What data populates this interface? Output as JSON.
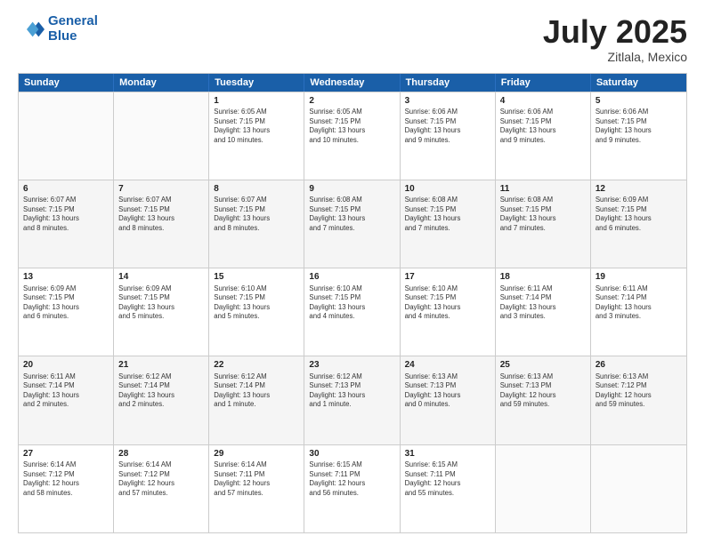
{
  "logo": {
    "line1": "General",
    "line2": "Blue"
  },
  "title": "July 2025",
  "subtitle": "Zitlala, Mexico",
  "headers": [
    "Sunday",
    "Monday",
    "Tuesday",
    "Wednesday",
    "Thursday",
    "Friday",
    "Saturday"
  ],
  "weeks": [
    [
      {
        "day": "",
        "info": ""
      },
      {
        "day": "",
        "info": ""
      },
      {
        "day": "1",
        "info": "Sunrise: 6:05 AM\nSunset: 7:15 PM\nDaylight: 13 hours\nand 10 minutes."
      },
      {
        "day": "2",
        "info": "Sunrise: 6:05 AM\nSunset: 7:15 PM\nDaylight: 13 hours\nand 10 minutes."
      },
      {
        "day": "3",
        "info": "Sunrise: 6:06 AM\nSunset: 7:15 PM\nDaylight: 13 hours\nand 9 minutes."
      },
      {
        "day": "4",
        "info": "Sunrise: 6:06 AM\nSunset: 7:15 PM\nDaylight: 13 hours\nand 9 minutes."
      },
      {
        "day": "5",
        "info": "Sunrise: 6:06 AM\nSunset: 7:15 PM\nDaylight: 13 hours\nand 9 minutes."
      }
    ],
    [
      {
        "day": "6",
        "info": "Sunrise: 6:07 AM\nSunset: 7:15 PM\nDaylight: 13 hours\nand 8 minutes."
      },
      {
        "day": "7",
        "info": "Sunrise: 6:07 AM\nSunset: 7:15 PM\nDaylight: 13 hours\nand 8 minutes."
      },
      {
        "day": "8",
        "info": "Sunrise: 6:07 AM\nSunset: 7:15 PM\nDaylight: 13 hours\nand 8 minutes."
      },
      {
        "day": "9",
        "info": "Sunrise: 6:08 AM\nSunset: 7:15 PM\nDaylight: 13 hours\nand 7 minutes."
      },
      {
        "day": "10",
        "info": "Sunrise: 6:08 AM\nSunset: 7:15 PM\nDaylight: 13 hours\nand 7 minutes."
      },
      {
        "day": "11",
        "info": "Sunrise: 6:08 AM\nSunset: 7:15 PM\nDaylight: 13 hours\nand 7 minutes."
      },
      {
        "day": "12",
        "info": "Sunrise: 6:09 AM\nSunset: 7:15 PM\nDaylight: 13 hours\nand 6 minutes."
      }
    ],
    [
      {
        "day": "13",
        "info": "Sunrise: 6:09 AM\nSunset: 7:15 PM\nDaylight: 13 hours\nand 6 minutes."
      },
      {
        "day": "14",
        "info": "Sunrise: 6:09 AM\nSunset: 7:15 PM\nDaylight: 13 hours\nand 5 minutes."
      },
      {
        "day": "15",
        "info": "Sunrise: 6:10 AM\nSunset: 7:15 PM\nDaylight: 13 hours\nand 5 minutes."
      },
      {
        "day": "16",
        "info": "Sunrise: 6:10 AM\nSunset: 7:15 PM\nDaylight: 13 hours\nand 4 minutes."
      },
      {
        "day": "17",
        "info": "Sunrise: 6:10 AM\nSunset: 7:15 PM\nDaylight: 13 hours\nand 4 minutes."
      },
      {
        "day": "18",
        "info": "Sunrise: 6:11 AM\nSunset: 7:14 PM\nDaylight: 13 hours\nand 3 minutes."
      },
      {
        "day": "19",
        "info": "Sunrise: 6:11 AM\nSunset: 7:14 PM\nDaylight: 13 hours\nand 3 minutes."
      }
    ],
    [
      {
        "day": "20",
        "info": "Sunrise: 6:11 AM\nSunset: 7:14 PM\nDaylight: 13 hours\nand 2 minutes."
      },
      {
        "day": "21",
        "info": "Sunrise: 6:12 AM\nSunset: 7:14 PM\nDaylight: 13 hours\nand 2 minutes."
      },
      {
        "day": "22",
        "info": "Sunrise: 6:12 AM\nSunset: 7:14 PM\nDaylight: 13 hours\nand 1 minute."
      },
      {
        "day": "23",
        "info": "Sunrise: 6:12 AM\nSunset: 7:13 PM\nDaylight: 13 hours\nand 1 minute."
      },
      {
        "day": "24",
        "info": "Sunrise: 6:13 AM\nSunset: 7:13 PM\nDaylight: 13 hours\nand 0 minutes."
      },
      {
        "day": "25",
        "info": "Sunrise: 6:13 AM\nSunset: 7:13 PM\nDaylight: 12 hours\nand 59 minutes."
      },
      {
        "day": "26",
        "info": "Sunrise: 6:13 AM\nSunset: 7:12 PM\nDaylight: 12 hours\nand 59 minutes."
      }
    ],
    [
      {
        "day": "27",
        "info": "Sunrise: 6:14 AM\nSunset: 7:12 PM\nDaylight: 12 hours\nand 58 minutes."
      },
      {
        "day": "28",
        "info": "Sunrise: 6:14 AM\nSunset: 7:12 PM\nDaylight: 12 hours\nand 57 minutes."
      },
      {
        "day": "29",
        "info": "Sunrise: 6:14 AM\nSunset: 7:11 PM\nDaylight: 12 hours\nand 57 minutes."
      },
      {
        "day": "30",
        "info": "Sunrise: 6:15 AM\nSunset: 7:11 PM\nDaylight: 12 hours\nand 56 minutes."
      },
      {
        "day": "31",
        "info": "Sunrise: 6:15 AM\nSunset: 7:11 PM\nDaylight: 12 hours\nand 55 minutes."
      },
      {
        "day": "",
        "info": ""
      },
      {
        "day": "",
        "info": ""
      }
    ]
  ]
}
